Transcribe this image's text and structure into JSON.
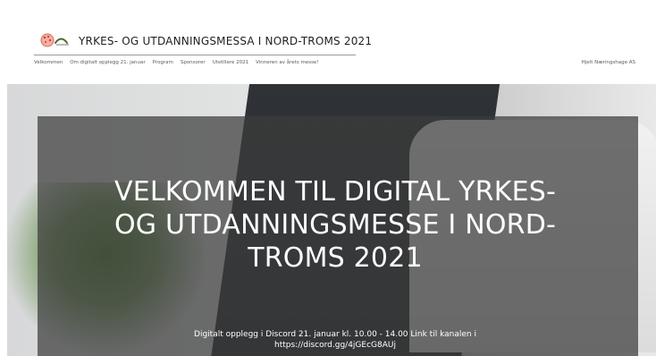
{
  "header": {
    "site_title": "YRKES- OG UTDANNINGSMESSA I NORD-TROMS 2021"
  },
  "nav": {
    "items": [
      {
        "label": "Velkommen"
      },
      {
        "label": "Om digitalt opplegg 21. januar"
      },
      {
        "label": "Program"
      },
      {
        "label": "Sponsorer"
      },
      {
        "label": "Utstillere 2021"
      },
      {
        "label": "Vinneren av årets messe!"
      }
    ],
    "right_label": "Hjelt Næringshage AS"
  },
  "hero": {
    "title": "VELKOMMEN TIL DIGITAL YRKES- OG UTDANNINGSMESSE I NORD-TROMS 2021",
    "subtitle": "Digitalt opplegg i Discord 21. januar kl. 10.00 - 14.00 Link til kanalen i https://discord.gg/4jGEcG8AUj"
  },
  "colors": {
    "overlay": "#3c3c3c",
    "text": "#ffffff",
    "header_text": "#1f1f1f"
  },
  "icons": {
    "logo": "event-logo-icon"
  }
}
